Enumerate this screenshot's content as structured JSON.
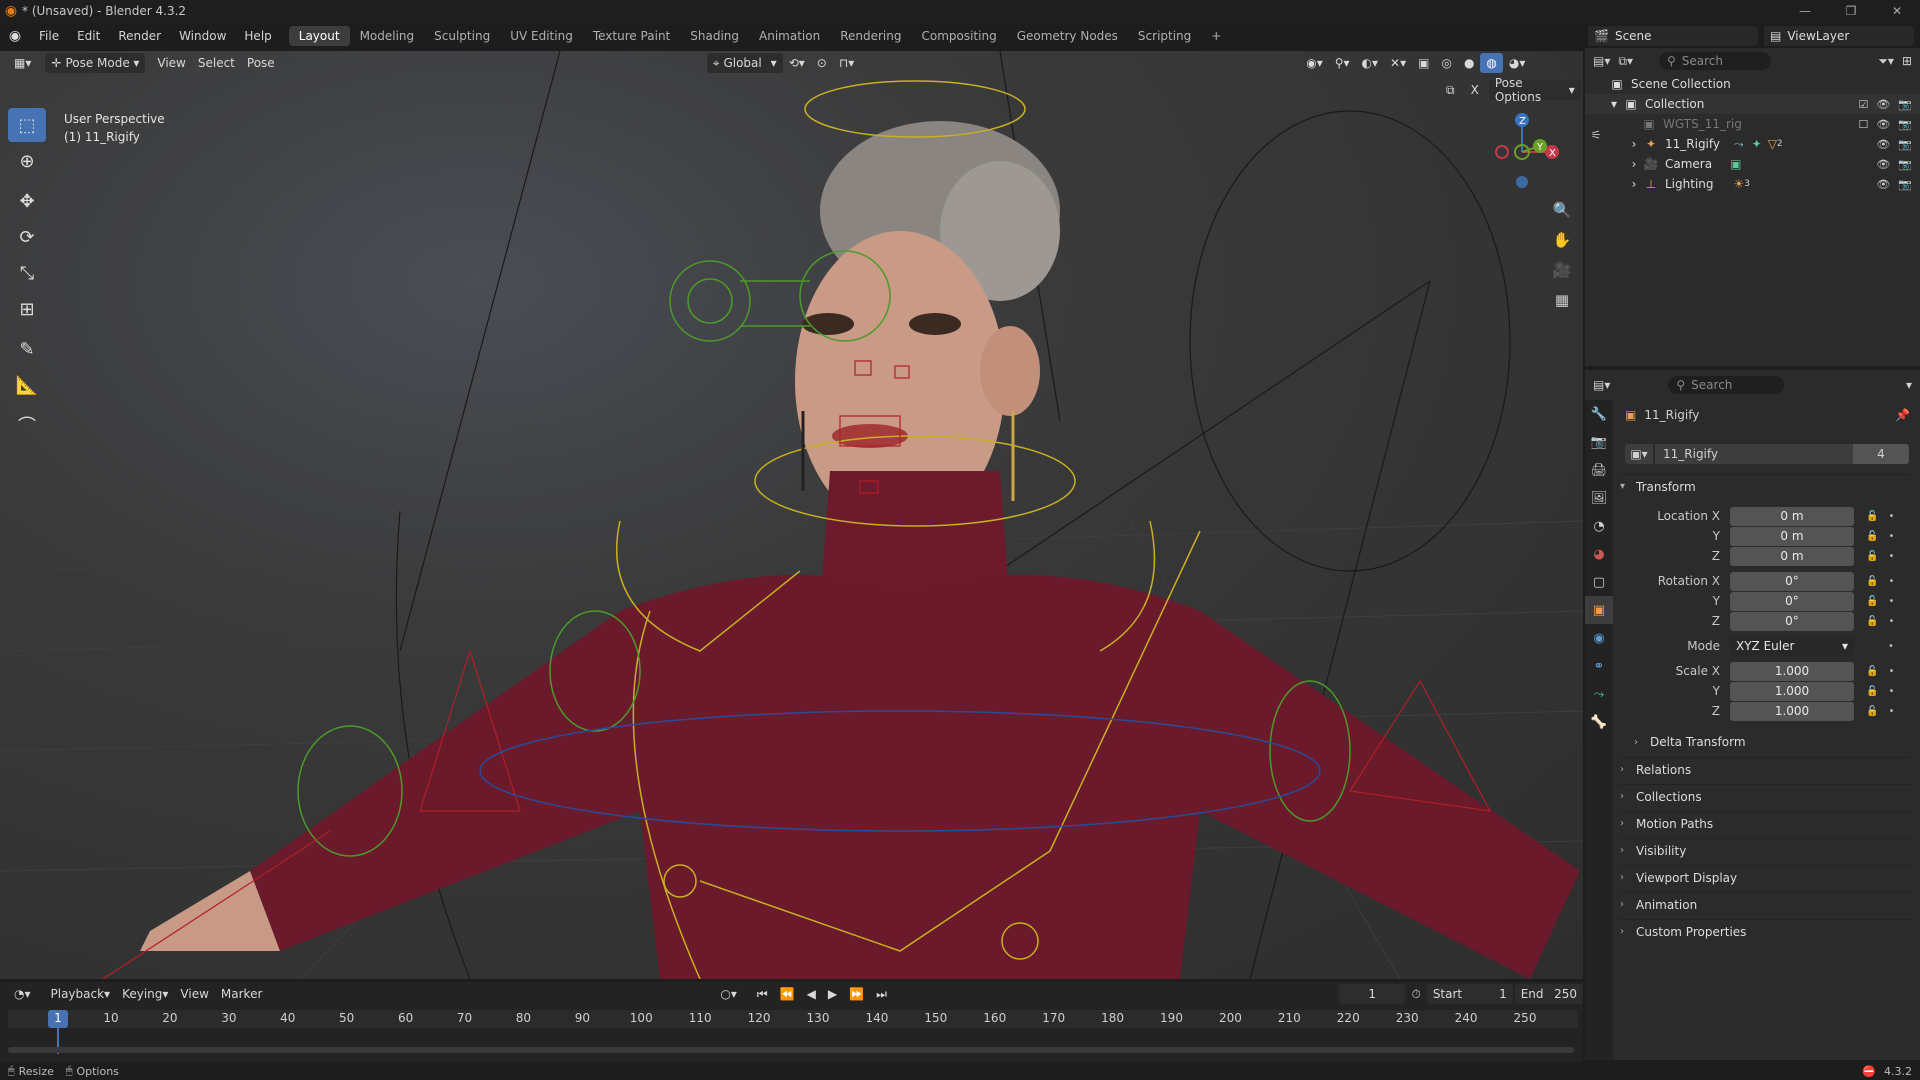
{
  "window": {
    "title": "* (Unsaved) - Blender 4.3.2"
  },
  "menu": [
    "File",
    "Edit",
    "Render",
    "Window",
    "Help"
  ],
  "workspaces": [
    {
      "label": "Layout",
      "active": true
    },
    {
      "label": "Modeling"
    },
    {
      "label": "Sculpting"
    },
    {
      "label": "UV Editing"
    },
    {
      "label": "Texture Paint"
    },
    {
      "label": "Shading"
    },
    {
      "label": "Animation"
    },
    {
      "label": "Rendering"
    },
    {
      "label": "Compositing"
    },
    {
      "label": "Geometry Nodes"
    },
    {
      "label": "Scripting"
    },
    {
      "label": "+"
    }
  ],
  "scene": {
    "label": "Scene",
    "viewlayer": "ViewLayer"
  },
  "viewport": {
    "mode": "Pose Mode",
    "menus": [
      "View",
      "Select",
      "Pose"
    ],
    "orientation": "Global",
    "pose_options": "Pose Options",
    "perspective_text": "User Perspective",
    "active_object_text": "(1) 11_Rigify",
    "gizmo_axes": {
      "x": "X",
      "y": "Y",
      "z": "Z"
    }
  },
  "outliner": {
    "search_placeholder": "Search",
    "root": "Scene Collection",
    "items": [
      {
        "label": "Collection",
        "level": 1
      },
      {
        "label": "WGTS_11_rig",
        "level": 2
      },
      {
        "label": "11_Rigify",
        "level": 2
      },
      {
        "label": "Camera",
        "level": 2
      },
      {
        "label": "Lighting",
        "level": 2
      }
    ],
    "lighting_count": "3",
    "rigify_count": "2"
  },
  "properties": {
    "search_placeholder": "Search",
    "object_name": "11_Rigify",
    "datablock_name": "11_Rigify",
    "datablock_users": "4",
    "transform_label": "Transform",
    "location": {
      "label_x": "Location X",
      "label_y": "Y",
      "label_z": "Z",
      "x": "0 m",
      "y": "0 m",
      "z": "0 m"
    },
    "rotation": {
      "label_x": "Rotation X",
      "label_y": "Y",
      "label_z": "Z",
      "x": "0°",
      "y": "0°",
      "z": "0°"
    },
    "mode": {
      "label": "Mode",
      "value": "XYZ Euler"
    },
    "scale": {
      "label_x": "Scale X",
      "label_y": "Y",
      "label_z": "Z",
      "x": "1.000",
      "y": "1.000",
      "z": "1.000"
    },
    "sections": [
      "Delta Transform",
      "Relations",
      "Collections",
      "Motion Paths",
      "Visibility",
      "Viewport Display",
      "Animation",
      "Custom Properties"
    ]
  },
  "timeline": {
    "menus": [
      "Playback",
      "Keying",
      "View",
      "Marker"
    ],
    "current_frame": "1",
    "start_label": "Start",
    "start": "1",
    "end_label": "End",
    "end": "250",
    "ticks": [
      "1",
      "10",
      "20",
      "30",
      "40",
      "50",
      "60",
      "70",
      "80",
      "90",
      "100",
      "110",
      "120",
      "130",
      "140",
      "150",
      "160",
      "170",
      "180",
      "190",
      "200",
      "210",
      "220",
      "230",
      "240",
      "250"
    ]
  },
  "statusbar": {
    "left1": "Resize",
    "left2": "Options",
    "version": "4.3.2"
  },
  "colors": {
    "accent": "#4772b3",
    "bone_yellow": "#c8b020",
    "bone_green": "#4c9a2a",
    "bone_red": "#b0202a",
    "sweater": "#6a1a2a"
  }
}
